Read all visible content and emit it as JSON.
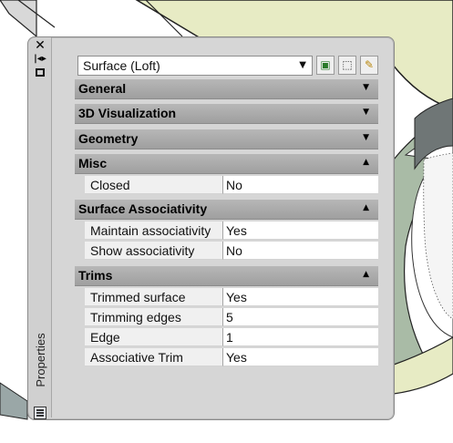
{
  "palette": {
    "title": "Properties",
    "close_icon": "close-icon",
    "autohide_icon": "autohide-icon",
    "menu_icon": "properties-menu-icon",
    "settings_icon": "palette-settings-icon"
  },
  "selector": {
    "value": "Surface (Loft)",
    "arrow_icon": "dropdown-arrow-icon"
  },
  "toolbar": {
    "quick_select_icon": "quick-select-icon",
    "select_objects_icon": "select-objects-icon",
    "toggle_pickadd_icon": "toggle-pickadd-icon"
  },
  "sections": [
    {
      "label": "General",
      "state": "collapsed"
    },
    {
      "label": "3D Visualization",
      "state": "collapsed"
    },
    {
      "label": "Geometry",
      "state": "collapsed"
    },
    {
      "label": "Misc",
      "state": "expanded",
      "rows": [
        {
          "name": "Closed",
          "value": "No"
        }
      ]
    },
    {
      "label": "Surface Associativity",
      "state": "expanded",
      "rows": [
        {
          "name": "Maintain associativity",
          "value": "Yes"
        },
        {
          "name": "Show associativity",
          "value": "No"
        }
      ]
    },
    {
      "label": "Trims",
      "state": "expanded",
      "rows": [
        {
          "name": "Trimmed surface",
          "value": "Yes"
        },
        {
          "name": "Trimming edges",
          "value": "5"
        },
        {
          "name": "Edge",
          "value": "1"
        },
        {
          "name": "Associative Trim",
          "value": "Yes"
        }
      ]
    }
  ],
  "colors": {
    "viewport_surface": "#e7ebc4",
    "viewport_edge": "#9ab4b4",
    "section_header": "#a9a9a9",
    "name_cell": "#f0f0f0",
    "value_cell": "#ffffff"
  }
}
